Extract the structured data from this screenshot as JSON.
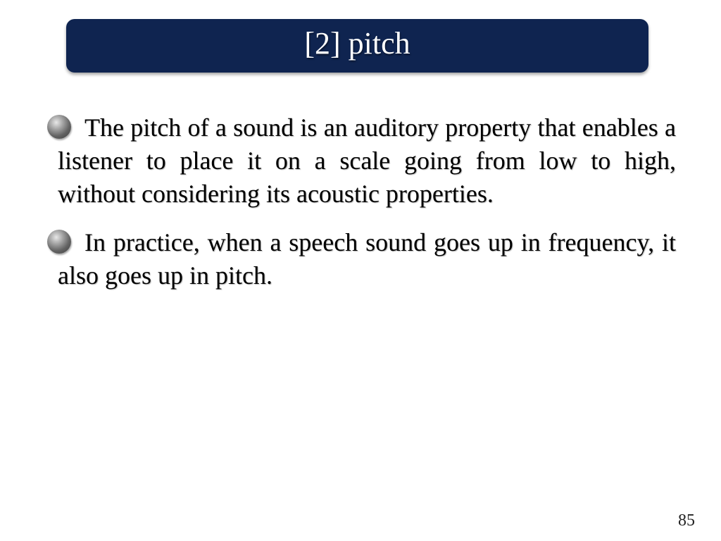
{
  "slide": {
    "title": "[2] pitch",
    "bullets": [
      "The pitch of a sound is an auditory property that enables a listener to place it on a scale going from low to high, without considering its acoustic properties.",
      "In practice, when a speech sound goes up in frequency, it also goes up in pitch."
    ],
    "page_number": "85"
  },
  "colors": {
    "title_bar": "#0f2450",
    "title_text": "#ffffff",
    "body_text": "#000000",
    "bullet": "#626262"
  },
  "icons": {
    "bullet": "round-gray-bullet-icon"
  }
}
